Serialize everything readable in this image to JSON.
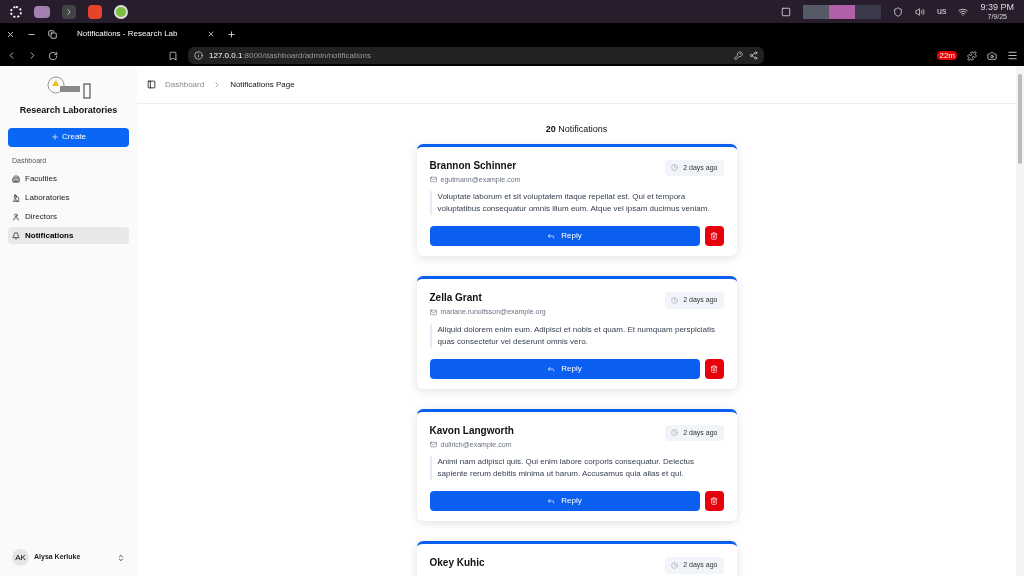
{
  "os_bar": {
    "keyboard": "us",
    "time": "9:39 PM",
    "date": "7/9/25"
  },
  "browser": {
    "tab_title": "Notifications - Research Lab",
    "url_host": "127.0.0.1",
    "url_rest": ":8000/dashboard/admin/notifications",
    "extension_badge": "22m"
  },
  "sidebar": {
    "brand": "Research Laboratories",
    "create_label": "Create",
    "group_label": "Dashboard",
    "items": [
      {
        "label": "Faculties",
        "selected": false
      },
      {
        "label": "Laboratories",
        "selected": false
      },
      {
        "label": "Directors",
        "selected": false
      },
      {
        "label": "Notifications",
        "selected": true
      }
    ],
    "user": {
      "initials": "AK",
      "name": "Alysa Kerluke"
    }
  },
  "breadcrumb": [
    {
      "label": "Dashboard",
      "current": false
    },
    {
      "label": "Notifications Page",
      "current": true
    }
  ],
  "heading": "**20** Notifications",
  "notifications": [
    {
      "name": "Brannon Schinner",
      "email": "egutmann@example.com",
      "time": "2 days ago",
      "message": "Voluptate laborum et sit voluptatem itaque repellat est. Qui et tempora voluptatibus consequatur omnis illum eum. Atque vel ipsam ducimus veniam.",
      "reply_label": "Reply"
    },
    {
      "name": "Zella Grant",
      "email": "mariane.runolfsson@example.org",
      "time": "2 days ago",
      "message": "Aliquid dolorem enim eum. Adipisci et nobis et quam. Et numquam perspiciatis quas consectetur vel deserunt omnis vero.",
      "reply_label": "Reply"
    },
    {
      "name": "Kavon Langworth",
      "email": "dullrich@example.com",
      "time": "2 days ago",
      "message": "Animi nam adipisci quis. Qui enim labore corporis consequatur. Delectus sapiente rerum debitis minima ut harum. Accusamus quia alias et qui.",
      "reply_label": "Reply"
    },
    {
      "name": "Okey Kuhic",
      "time": "2 days ago"
    }
  ]
}
